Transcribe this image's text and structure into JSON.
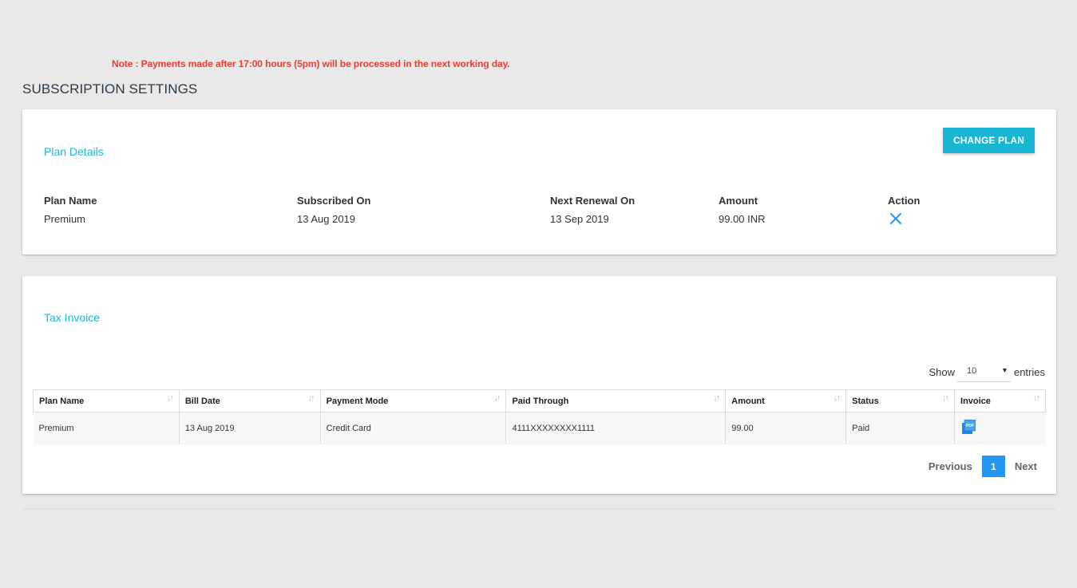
{
  "note": "Note : Payments made after 17:00 hours (5pm) will be processed in the next working day.",
  "page_title": "SUBSCRIPTION SETTINGS",
  "plan_details": {
    "heading": "Plan Details",
    "change_plan_label": "CHANGE PLAN",
    "columns": {
      "plan_name": "Plan Name",
      "subscribed_on": "Subscribed On",
      "next_renewal_on": "Next Renewal On",
      "amount": "Amount",
      "action": "Action"
    },
    "values": {
      "plan_name": "Premium",
      "subscribed_on": "13 Aug 2019",
      "next_renewal_on": "13 Sep 2019",
      "amount": "99.00 INR"
    },
    "action_icon": "close-icon"
  },
  "tax_invoice": {
    "heading": "Tax Invoice",
    "show_label": "Show",
    "entries_value": "10",
    "entries_label": "entries",
    "headers": [
      "Plan Name",
      "Bill Date",
      "Payment Mode",
      "Paid Through",
      "Amount",
      "Status",
      "Invoice"
    ],
    "rows": [
      {
        "plan_name": "Premium",
        "bill_date": "13 Aug 2019",
        "payment_mode": "Credit Card",
        "paid_through": "4111XXXXXXXX1111",
        "amount": "99.00",
        "status": "Paid",
        "invoice_icon": "pdf-icon"
      }
    ],
    "pagination": {
      "previous": "Previous",
      "current_page": "1",
      "next": "Next"
    }
  },
  "colors": {
    "accent": "#19b6d3",
    "note_red": "#f03a2e",
    "page_active": "#2196f3",
    "close_icon": "#2196f3"
  }
}
